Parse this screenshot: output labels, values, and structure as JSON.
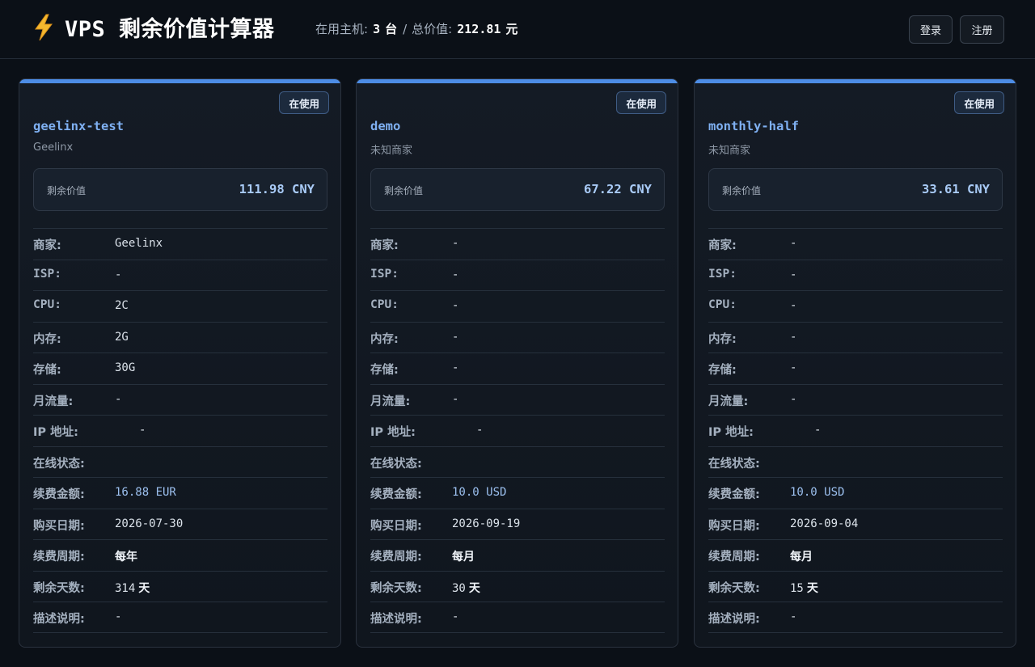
{
  "header": {
    "title": "VPS 剩余价值计算器",
    "icon": "lightning-bolt-icon",
    "active_label": "在用主机:",
    "active_count": "3",
    "active_unit": "台",
    "separator": "/",
    "total_label": "总价值:",
    "total_value": "212.81",
    "total_unit": "元",
    "login_label": "登录",
    "register_label": "注册"
  },
  "colors": {
    "accent": "#4d8de6",
    "host_name": "#7fb0f2",
    "value": "#a9cbf7",
    "background": "#0b1017"
  },
  "labels": {
    "remaining_value": "剩余价值",
    "merchant": "商家:",
    "isp": "ISP:",
    "cpu": "CPU:",
    "memory": "内存:",
    "storage": "存储:",
    "traffic": "月流量:",
    "ip": "IP 地址:",
    "online": "在线状态:",
    "renew_amount": "续费金额:",
    "purchase_date": "购买日期:",
    "renew_cycle": "续费周期:",
    "remaining_days": "剩余天数:",
    "description": "描述说明:",
    "days_unit": "天"
  },
  "hosts": [
    {
      "status": "在使用",
      "name": "geelinx-test",
      "vendor": "Geelinx",
      "remaining_value": "111.98 CNY",
      "merchant": "Geelinx",
      "isp": "-",
      "cpu": "2C",
      "memory": "2G",
      "storage": "30G",
      "traffic": "-",
      "ip": "-",
      "online": "",
      "renew_amount": "16.88 EUR",
      "purchase_date": "2026-07-30",
      "renew_cycle": "每年",
      "remaining_days": "314",
      "description": "-"
    },
    {
      "status": "在使用",
      "name": "demo",
      "vendor": "未知商家",
      "remaining_value": "67.22 CNY",
      "merchant": "-",
      "isp": "-",
      "cpu": "-",
      "memory": "-",
      "storage": "-",
      "traffic": "-",
      "ip": "-",
      "online": "",
      "renew_amount": "10.0 USD",
      "purchase_date": "2026-09-19",
      "renew_cycle": "每月",
      "remaining_days": "30",
      "description": "-"
    },
    {
      "status": "在使用",
      "name": "monthly-half",
      "vendor": "未知商家",
      "remaining_value": "33.61 CNY",
      "merchant": "-",
      "isp": "-",
      "cpu": "-",
      "memory": "-",
      "storage": "-",
      "traffic": "-",
      "ip": "-",
      "online": "",
      "renew_amount": "10.0 USD",
      "purchase_date": "2026-09-04",
      "renew_cycle": "每月",
      "remaining_days": "15",
      "description": "-"
    }
  ]
}
